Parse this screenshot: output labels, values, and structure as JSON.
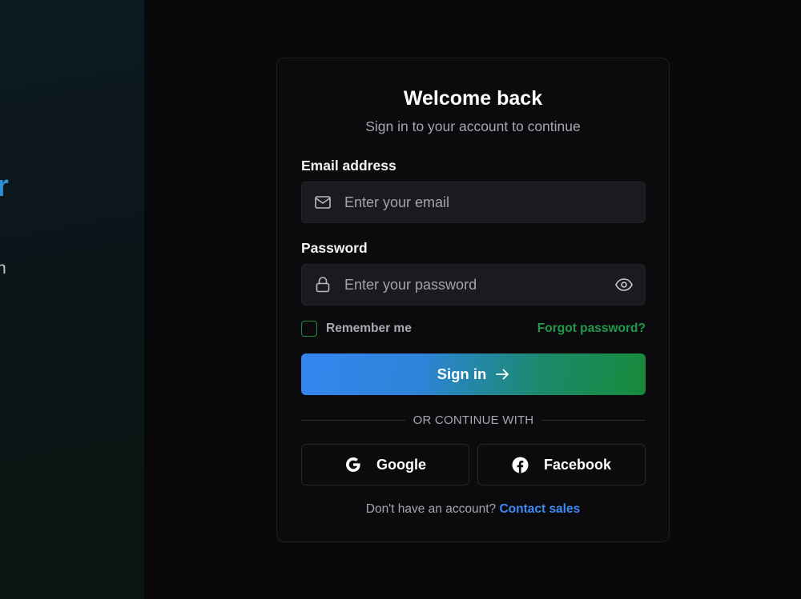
{
  "hero": {
    "heading_fragment": "r",
    "subtitle_fragment": "h"
  },
  "card": {
    "title": "Welcome back",
    "subtitle": "Sign in to your account to continue",
    "email": {
      "label": "Email address",
      "placeholder": "Enter your email",
      "value": "",
      "icon": "mail-icon"
    },
    "password": {
      "label": "Password",
      "placeholder": "Enter your password",
      "value": "",
      "icon": "lock-icon",
      "toggle_icon": "eye-icon"
    },
    "remember_label": "Remember me",
    "remember_checked": false,
    "forgot_label": "Forgot password?",
    "signin_label": "Sign in",
    "divider_text": "OR CONTINUE WITH",
    "social": [
      {
        "label": "Google",
        "icon": "google-icon"
      },
      {
        "label": "Facebook",
        "icon": "facebook-icon"
      }
    ],
    "footer": {
      "text": "Don't have an account?",
      "link": "Contact sales"
    }
  },
  "colors": {
    "background": "#09090b",
    "card": "#0b0b0e",
    "accent_blue": "#3b8cf5",
    "accent_green": "#1e9a48",
    "hero_heading": "#2f8fd0"
  }
}
